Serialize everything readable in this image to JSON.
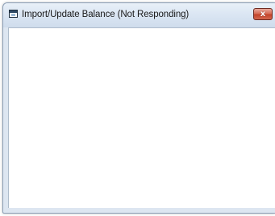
{
  "window": {
    "title": "Import/Update Balance (Not Responding)",
    "icon": "app-window-icon",
    "close_glyph": "x",
    "close_icon": "close-icon"
  },
  "colors": {
    "frame": "#dde6f1",
    "close_button": "#c2432a",
    "client_background": "#ffffff"
  }
}
